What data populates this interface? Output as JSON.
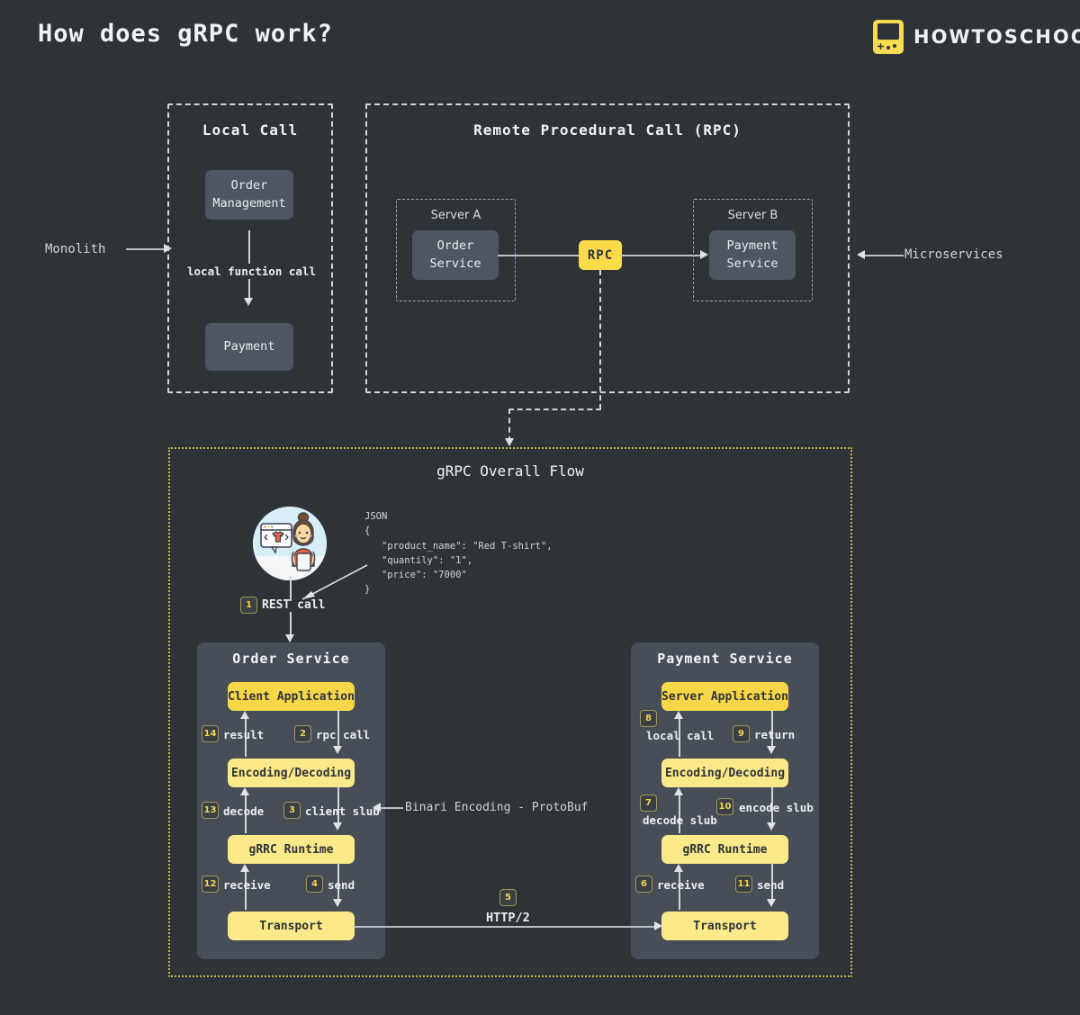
{
  "header": {
    "title": "How does gRPC work?",
    "brand": "HOWTOSCHOOL",
    "brand_icon": "gameboy-icon"
  },
  "annotations": {
    "monolith": "Monolith",
    "microservices": "Microservices"
  },
  "local_call": {
    "title": "Local Call",
    "box_top": "Order\nManagement",
    "box_top_line1": "Order",
    "box_top_line2": "Management",
    "edge_label": "local function call",
    "box_bottom": "Payment"
  },
  "rpc": {
    "title": "Remote Procedural Call (RPC)",
    "server_a": {
      "title": "Server A",
      "service_line1": "Order",
      "service_line2": "Service"
    },
    "server_b": {
      "title": "Server B",
      "service_line1": "Payment",
      "service_line2": "Service"
    },
    "center_node": "RPC"
  },
  "flow": {
    "title": "gRPC Overall Flow",
    "json": {
      "label": "JSON",
      "body": "{\n   \"product_name\": \"Red T-shirt\",\n   \"quantily\": \"1\",\n   \"price\": \"7000\"\n}",
      "fields": [
        {
          "key": "product_name",
          "value": "Red T-shirt"
        },
        {
          "key": "quantily",
          "value": "1"
        },
        {
          "key": "price",
          "value": "7000"
        }
      ]
    },
    "rest_call": {
      "step": "1",
      "label": "REST call"
    },
    "protobuf_note": "Binari Encoding - ProtoBuf",
    "transport_link": {
      "step": "5",
      "label": "HTTP/2"
    },
    "order_service": {
      "title": "Order Service",
      "layers": [
        {
          "name": "Client Application",
          "highlight": true
        },
        {
          "name": "Encoding/Decoding",
          "highlight": false
        },
        {
          "name": "gRRC Runtime",
          "highlight": false
        },
        {
          "name": "Transport",
          "highlight": false
        }
      ],
      "steps": [
        {
          "step": "14",
          "label": "result",
          "dir": "up"
        },
        {
          "step": "2",
          "label": "rpc call",
          "dir": "down"
        },
        {
          "step": "13",
          "label": "decode",
          "dir": "up"
        },
        {
          "step": "3",
          "label": "client slub",
          "dir": "down"
        },
        {
          "step": "12",
          "label": "receive",
          "dir": "up"
        },
        {
          "step": "4",
          "label": "send",
          "dir": "down"
        }
      ]
    },
    "payment_service": {
      "title": "Payment Service",
      "layers": [
        {
          "name": "Server Application",
          "highlight": true
        },
        {
          "name": "Encoding/Decoding",
          "highlight": false
        },
        {
          "name": "gRRC Runtime",
          "highlight": false
        },
        {
          "name": "Transport",
          "highlight": false
        }
      ],
      "steps": [
        {
          "step": "8",
          "label": "local call",
          "dir": "up"
        },
        {
          "step": "9",
          "label": "return",
          "dir": "down"
        },
        {
          "step": "7",
          "label": "decode slub",
          "dir": "up"
        },
        {
          "step": "10",
          "label": "encode slub",
          "dir": "down"
        },
        {
          "step": "6",
          "label": "receive",
          "dir": "up"
        },
        {
          "step": "11",
          "label": "send",
          "dir": "down"
        }
      ]
    }
  },
  "colors": {
    "background": "#2e3338",
    "accent_yellow": "#fbdb4a",
    "pale_yellow": "#fbe98a",
    "grey_box": "#4e5661",
    "service_panel": "#474e58",
    "text": "#e8eaed"
  }
}
